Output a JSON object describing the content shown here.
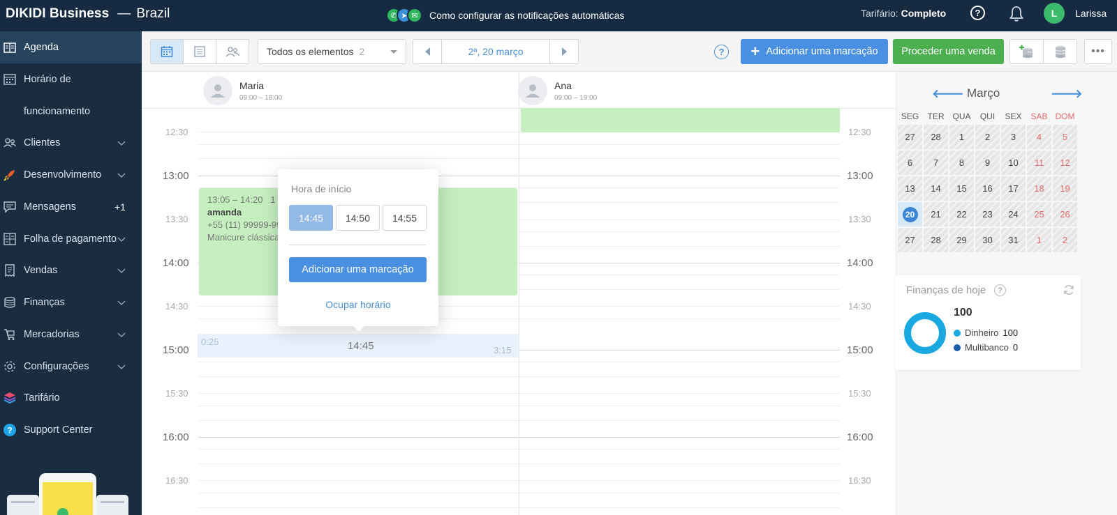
{
  "topbar": {
    "brand": "DIKIDI Business",
    "dash": "—",
    "country": "Brazil",
    "notification_link": "Como configurar as notificações automáticas",
    "tariff_label": "Tarifário:",
    "tariff_value": "Completo",
    "help_glyph": "?",
    "avatar_initial": "L",
    "user_name": "Larissa"
  },
  "sidebar": {
    "items": [
      {
        "label": "Agenda",
        "icon": "agenda-icon"
      },
      {
        "label": "Horário de",
        "icon": "calendar-icon"
      },
      {
        "label": "funcionamento"
      },
      {
        "label": "Clientes",
        "icon": "clients-icon"
      },
      {
        "label": "Desenvolvimento",
        "icon": "rocket-icon"
      },
      {
        "label": "Mensagens",
        "icon": "messages-icon",
        "badge": "+1"
      },
      {
        "label": "Folha de pagamento",
        "icon": "payroll-icon"
      },
      {
        "label": "Vendas",
        "icon": "sales-icon"
      },
      {
        "label": "Finanças",
        "icon": "coins-icon"
      },
      {
        "label": "Mercadorias",
        "icon": "cart-icon"
      },
      {
        "label": "Configurações",
        "icon": "gear-icon"
      },
      {
        "label": "Tarifário",
        "icon": "layers-icon"
      },
      {
        "label": "Support Center",
        "icon": "support-icon"
      }
    ]
  },
  "toolbar": {
    "filter_label": "Todos os elementos",
    "filter_count": "2",
    "date": "2ª, 20 março",
    "help_glyph": "?",
    "add_plus": "+",
    "add_label": "Adicionar uma marcação",
    "sale_label": "Proceder uma venda",
    "more_glyph": "•••"
  },
  "schedule": {
    "staff": [
      {
        "name": "Maria",
        "hours": "09:00 – 18:00"
      },
      {
        "name": "Ana",
        "hours": "09:00 – 19:00"
      }
    ],
    "times": [
      "12:30",
      "13:00",
      "13:30",
      "14:00",
      "14:30",
      "15:00",
      "15:30",
      "16:00",
      "16:30"
    ],
    "appointment": {
      "time": "13:05 – 14:20",
      "count": "1",
      "client": "amanda",
      "phone": "+55 (11) 99999-99",
      "service": "Manicure clássica"
    },
    "slot": {
      "before": "0:25",
      "time": "14:45",
      "after": "3:15"
    }
  },
  "popup": {
    "title": "Hora de início",
    "options": [
      "14:45",
      "14:50",
      "14:55"
    ],
    "selected_index": 0,
    "add_label": "Adicionar uma marcação",
    "block_label": "Ocupar horário"
  },
  "calendar": {
    "prev_glyph": "🡐",
    "next_glyph": "🡒",
    "month": "Março",
    "weekdays": [
      "SEG",
      "TER",
      "QUA",
      "QUI",
      "SEX",
      "SAB",
      "DOM"
    ],
    "weeks": [
      [
        "27",
        "28",
        "1",
        "2",
        "3",
        "4",
        "5"
      ],
      [
        "6",
        "7",
        "8",
        "9",
        "10",
        "11",
        "12"
      ],
      [
        "13",
        "14",
        "15",
        "16",
        "17",
        "18",
        "19"
      ],
      [
        "20",
        "21",
        "22",
        "23",
        "24",
        "25",
        "26"
      ],
      [
        "27",
        "28",
        "29",
        "30",
        "31",
        "1",
        "2"
      ]
    ],
    "today": "20"
  },
  "finance": {
    "title": "Finanças de hoje",
    "help_glyph": "?",
    "total": "100",
    "items": [
      {
        "label": "Dinheiro",
        "value": "100",
        "color": "#1aa8e0"
      },
      {
        "label": "Multibanco",
        "value": "0",
        "color": "#1f5fa8"
      }
    ]
  },
  "colors": {
    "topbar": "#162b42",
    "sidebar": "#1a2d40",
    "primary": "#4a90e2",
    "success": "#4cb050",
    "appointment": "#c6efc0",
    "weekend": "#e56b6b"
  }
}
